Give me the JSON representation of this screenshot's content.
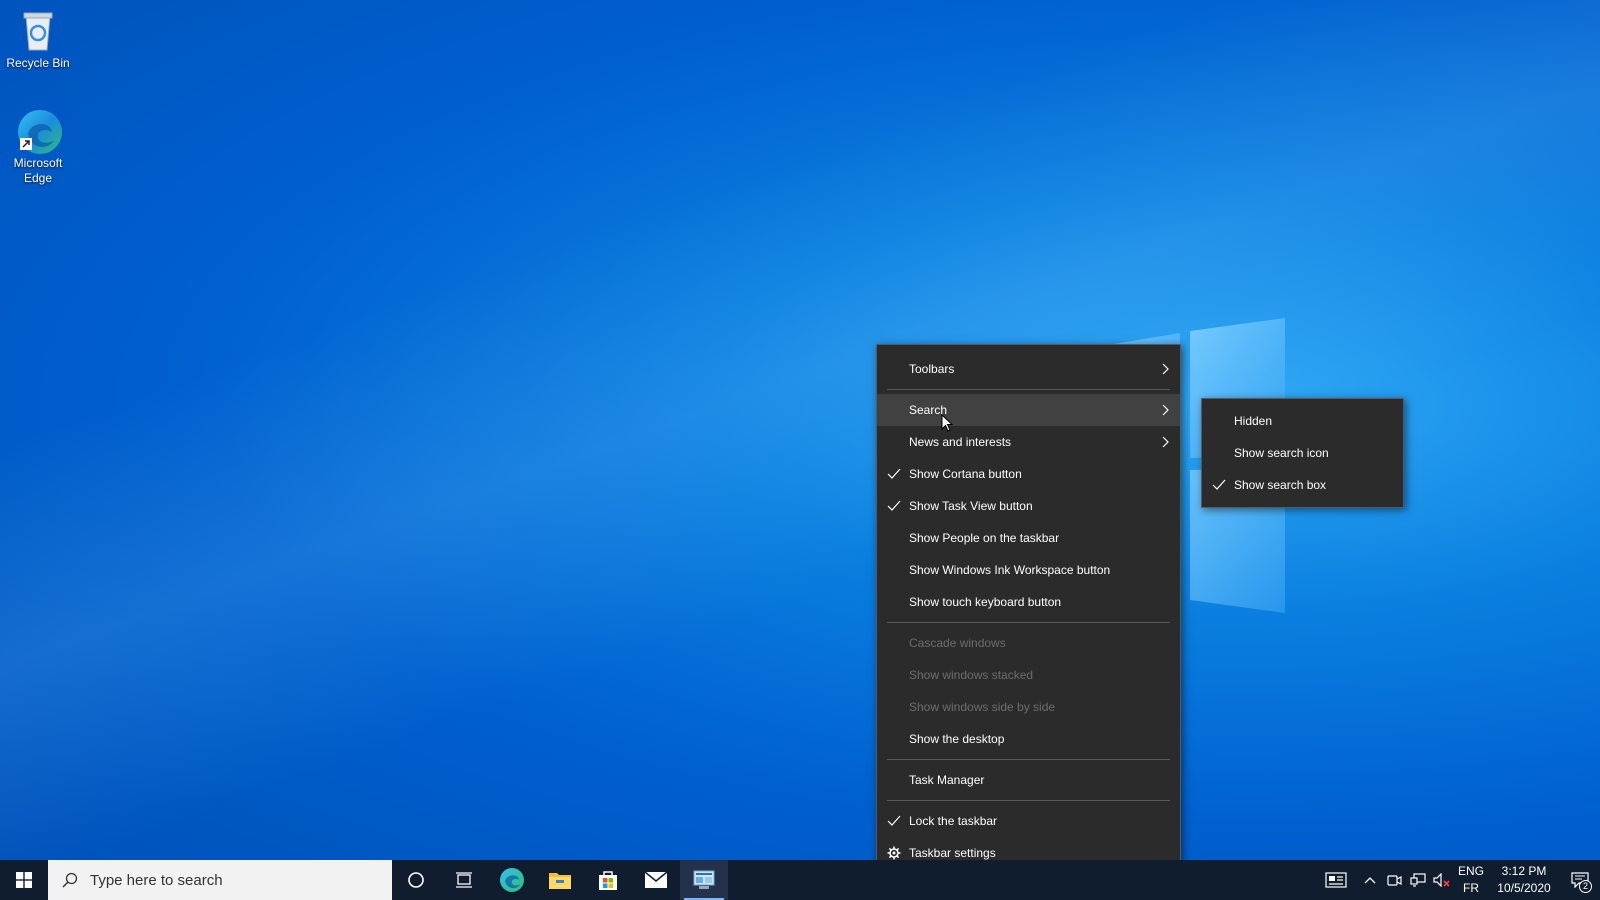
{
  "desktop": {
    "icons": [
      {
        "label": "Recycle Bin",
        "icon": "recycle-bin-icon"
      },
      {
        "label": "Microsoft Edge",
        "icon": "edge-icon"
      }
    ]
  },
  "context_menu": {
    "items": [
      {
        "label": "Toolbars",
        "checked": false,
        "submenu": true,
        "disabled": false
      },
      {
        "label": "Search",
        "checked": false,
        "submenu": true,
        "disabled": false,
        "highlighted": true
      },
      {
        "label": "News and interests",
        "checked": false,
        "submenu": true,
        "disabled": false
      },
      {
        "label": "Show Cortana button",
        "checked": true,
        "disabled": false
      },
      {
        "label": "Show Task View button",
        "checked": true,
        "disabled": false
      },
      {
        "label": "Show People on the taskbar",
        "checked": false,
        "disabled": false
      },
      {
        "label": "Show Windows Ink Workspace button",
        "checked": false,
        "disabled": false
      },
      {
        "label": "Show touch keyboard button",
        "checked": false,
        "disabled": false
      },
      {
        "label": "Cascade windows",
        "disabled": true
      },
      {
        "label": "Show windows stacked",
        "disabled": true
      },
      {
        "label": "Show windows side by side",
        "disabled": true
      },
      {
        "label": "Show the desktop",
        "disabled": false
      },
      {
        "label": "Task Manager",
        "disabled": false
      },
      {
        "label": "Lock the taskbar",
        "checked": true,
        "disabled": false
      },
      {
        "label": "Taskbar settings",
        "icon": "gear-icon",
        "disabled": false
      }
    ]
  },
  "search_submenu": {
    "items": [
      {
        "label": "Hidden",
        "checked": false
      },
      {
        "label": "Show search icon",
        "checked": false
      },
      {
        "label": "Show search box",
        "checked": true
      }
    ]
  },
  "taskbar": {
    "search_placeholder": "Type here to search",
    "pinned": [
      "cortana-icon",
      "task-view-icon",
      "edge-icon",
      "file-explorer-icon",
      "store-icon",
      "mail-icon",
      "control-panel-icon"
    ],
    "tray": {
      "lang_top": "ENG",
      "lang_bottom": "FR",
      "time": "3:12 PM",
      "date": "10/5/2020",
      "notification_count": "2"
    }
  },
  "colors": {
    "menu_bg": "#2b2b2b",
    "taskbar_bg": "#101d2e",
    "desktop_blue": "#0a7fe0"
  }
}
